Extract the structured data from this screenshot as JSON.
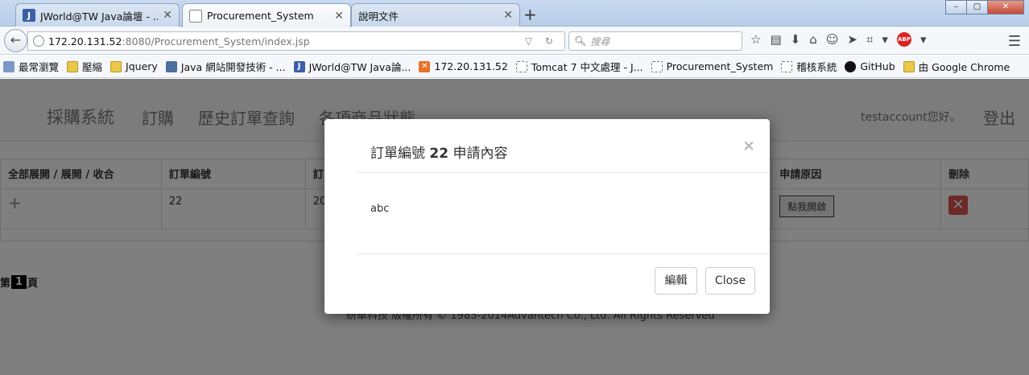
{
  "browser": {
    "tabs": [
      {
        "label": "JWorld@TW Java論壇 - ...",
        "icon": "jworld-favicon"
      },
      {
        "label": "Procurement_System",
        "icon": "page-favicon"
      },
      {
        "label": "說明文件",
        "icon": "none"
      }
    ],
    "window_controls": {
      "minimize": "–",
      "maximize": "▢",
      "close": "✕"
    },
    "url": {
      "host": "172.20.131.52",
      "path": ":8080/Procurement_System/index.jsp"
    },
    "search_placeholder": "搜尋",
    "bookmarks": [
      {
        "label": "最常瀏覽",
        "icon": "recent"
      },
      {
        "label": "壓縮",
        "icon": "folder"
      },
      {
        "label": "Jquery",
        "icon": "folder"
      },
      {
        "label": "Java 網站開發技術 - ...",
        "icon": "grid"
      },
      {
        "label": "JWorld@TW Java論...",
        "icon": "jworld"
      },
      {
        "label": "172.20.131.52",
        "icon": "xampp"
      },
      {
        "label": "Tomcat 7 中文處理 - J...",
        "icon": "dashed"
      },
      {
        "label": "Procurement_System",
        "icon": "dashed"
      },
      {
        "label": "稽核系統",
        "icon": "dashed"
      },
      {
        "label": "GitHub",
        "icon": "github"
      },
      {
        "label": "由 Google Chrome",
        "icon": "folder"
      }
    ]
  },
  "app": {
    "brand": "採購系統",
    "nav": [
      "訂購",
      "歷史訂單查詢",
      "各項商品狀態"
    ],
    "greeting": "testaccount您好。",
    "logout": "登出"
  },
  "table": {
    "headers": [
      "全部展開 / 展開 / 收合",
      "訂單編號",
      "訂",
      "申請原因",
      "刪除"
    ],
    "rows": [
      {
        "expand": "+",
        "order_no": "22",
        "date_partial": "20",
        "open_label": "點我開啟",
        "delete": "✕"
      }
    ]
  },
  "pager": {
    "prefix": "第",
    "current": "1",
    "suffix": "頁"
  },
  "footer": "研華科技 版權所有 © 1983-2014Advantech Co., Ltd. All Rights Reserved",
  "modal": {
    "title_prefix": "訂單編號",
    "order_no": "22",
    "title_suffix": "申請內容",
    "close_x": "×",
    "body": "abc",
    "edit_label": "編輯",
    "close_label": "Close"
  }
}
